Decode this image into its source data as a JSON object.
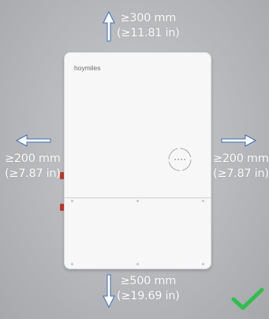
{
  "clearances": {
    "top": {
      "mm": "≥300 mm",
      "in": "(≥11.81 in)"
    },
    "left": {
      "mm": "≥200 mm",
      "in": "(≥7.87 in)"
    },
    "right": {
      "mm": "≥200 mm",
      "in": "(≥7.87 in)"
    },
    "bottom": {
      "mm": "≥500 mm",
      "in": "(≥19.69 in)"
    }
  },
  "device": {
    "brand": "hoymiles"
  },
  "colors": {
    "arrow_fill": "#ffffff",
    "arrow_stroke": "#3a6fb5",
    "check": "#2fbf4a"
  },
  "icons": [
    "arrow-up-icon",
    "arrow-left-icon",
    "arrow-right-icon",
    "arrow-down-icon",
    "checkmark-icon"
  ]
}
